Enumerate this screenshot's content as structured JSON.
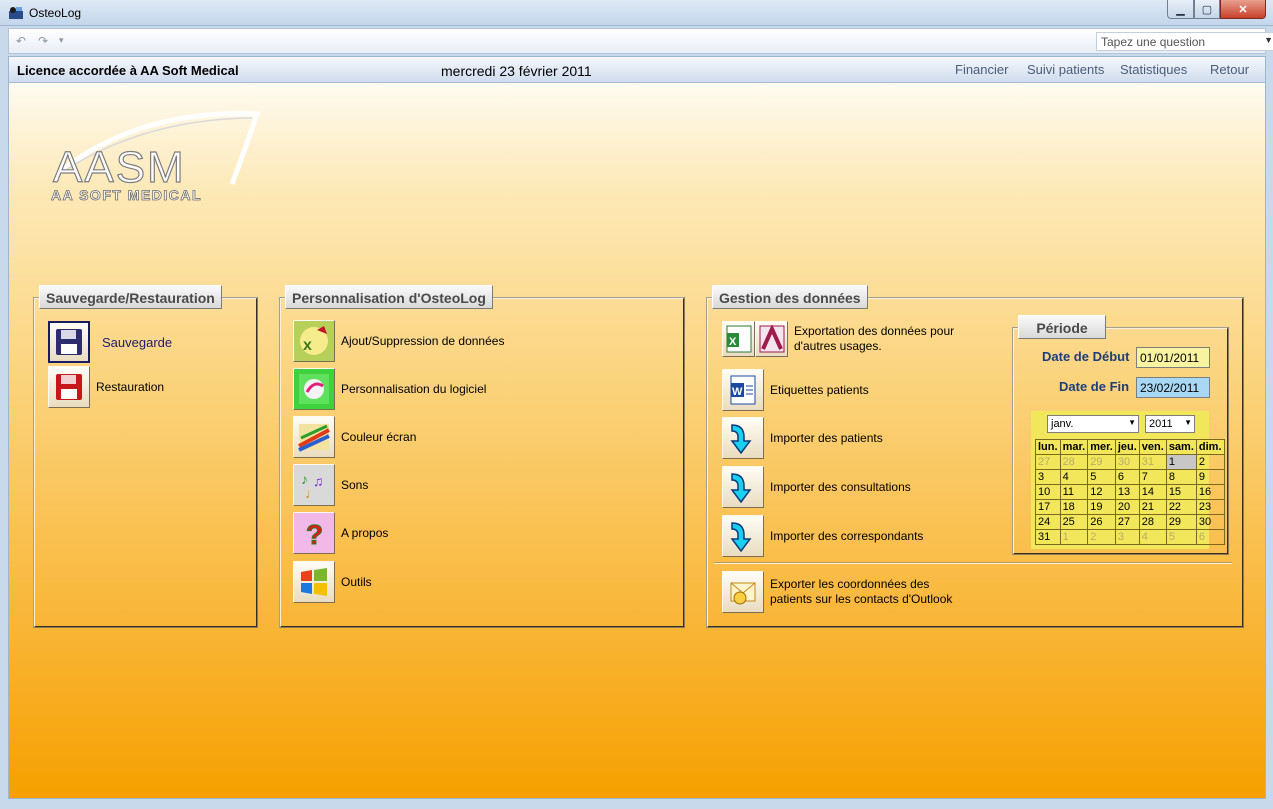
{
  "window": {
    "title": "OsteoLog"
  },
  "qat": {
    "question_placeholder": "Tapez une question"
  },
  "infobar": {
    "licence": "Licence accordée à  AA Soft Medical",
    "date": "mercredi 23 février 2011",
    "nav": [
      "Financier",
      "Suivi patients",
      "Statistiques",
      "Retour"
    ]
  },
  "logo": {
    "text": "AASM",
    "sub": "AA SOFT MEDICAL"
  },
  "sauvegarde": {
    "title": "Sauvegarde/Restauration",
    "items": [
      "Sauvegarde",
      "Restauration"
    ]
  },
  "perso": {
    "title": "Personnalisation d'OsteoLog",
    "items": [
      "Ajout/Suppression de données",
      "Personnalisation du logiciel",
      "Couleur écran",
      "Sons",
      "A propos",
      "Outils"
    ]
  },
  "gestion": {
    "title": "Gestion des données",
    "export_line1": "Exportation des données pour",
    "export_line2": "d'autres usages.",
    "items": [
      "Etiquettes patients",
      "Importer des patients",
      "Importer des consultations",
      "Importer des correspondants"
    ],
    "outlook_line1": "Exporter les coordonnées des",
    "outlook_line2": "patients sur les contacts d'Outlook"
  },
  "periode": {
    "title": "Période",
    "debut_label": "Date de Début",
    "debut_value": "01/01/2011",
    "fin_label": "Date de Fin",
    "fin_value": "23/02/2011"
  },
  "calendar": {
    "month": "janv.",
    "year": "2011",
    "headers": [
      "lun.",
      "mar.",
      "mer.",
      "jeu.",
      "ven.",
      "sam.",
      "dim."
    ],
    "weeks": [
      [
        "27",
        "28",
        "29",
        "30",
        "31",
        "1",
        "2"
      ],
      [
        "3",
        "4",
        "5",
        "6",
        "7",
        "8",
        "9"
      ],
      [
        "10",
        "11",
        "12",
        "13",
        "14",
        "15",
        "16"
      ],
      [
        "17",
        "18",
        "19",
        "20",
        "21",
        "22",
        "23"
      ],
      [
        "24",
        "25",
        "26",
        "27",
        "28",
        "29",
        "30"
      ],
      [
        "31",
        "1",
        "2",
        "3",
        "4",
        "5",
        "6"
      ]
    ],
    "other_month_first_row": 5,
    "other_month_last_row_from": 1,
    "today": "1",
    "colors": {
      "bg": "#f2e65b",
      "debut_field": "#f7f3a0",
      "fin_field": "#a9d8f5"
    }
  }
}
